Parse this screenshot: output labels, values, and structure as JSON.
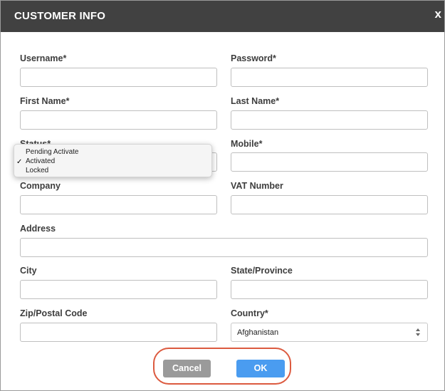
{
  "dialog": {
    "title": "CUSTOMER INFO",
    "close_label": "x"
  },
  "form": {
    "username": {
      "label": "Username*",
      "value": ""
    },
    "password": {
      "label": "Password*",
      "value": ""
    },
    "first_name": {
      "label": "First Name*",
      "value": ""
    },
    "last_name": {
      "label": "Last Name*",
      "value": ""
    },
    "status": {
      "label": "Status*",
      "selected": "Activated",
      "options": [
        "Pending Activate",
        "Activated",
        "Locked"
      ],
      "check_mark": "✓"
    },
    "mobile": {
      "label": "Mobile*",
      "value": ""
    },
    "company": {
      "label": "Company",
      "value": ""
    },
    "vat_number": {
      "label": "VAT Number",
      "value": ""
    },
    "address": {
      "label": "Address",
      "value": ""
    },
    "city": {
      "label": "City",
      "value": ""
    },
    "state_province": {
      "label": "State/Province",
      "value": ""
    },
    "zip_postal_code": {
      "label": "Zip/Postal Code",
      "value": ""
    },
    "country": {
      "label": "Country*",
      "selected": "Afghanistan"
    }
  },
  "buttons": {
    "cancel_label": "Cancel",
    "ok_label": "OK"
  },
  "colors": {
    "titlebar": "#414141",
    "ok_button": "#4a9cf0",
    "cancel_button": "#9a9a9a",
    "highlight_outline": "#dc5a3f"
  }
}
